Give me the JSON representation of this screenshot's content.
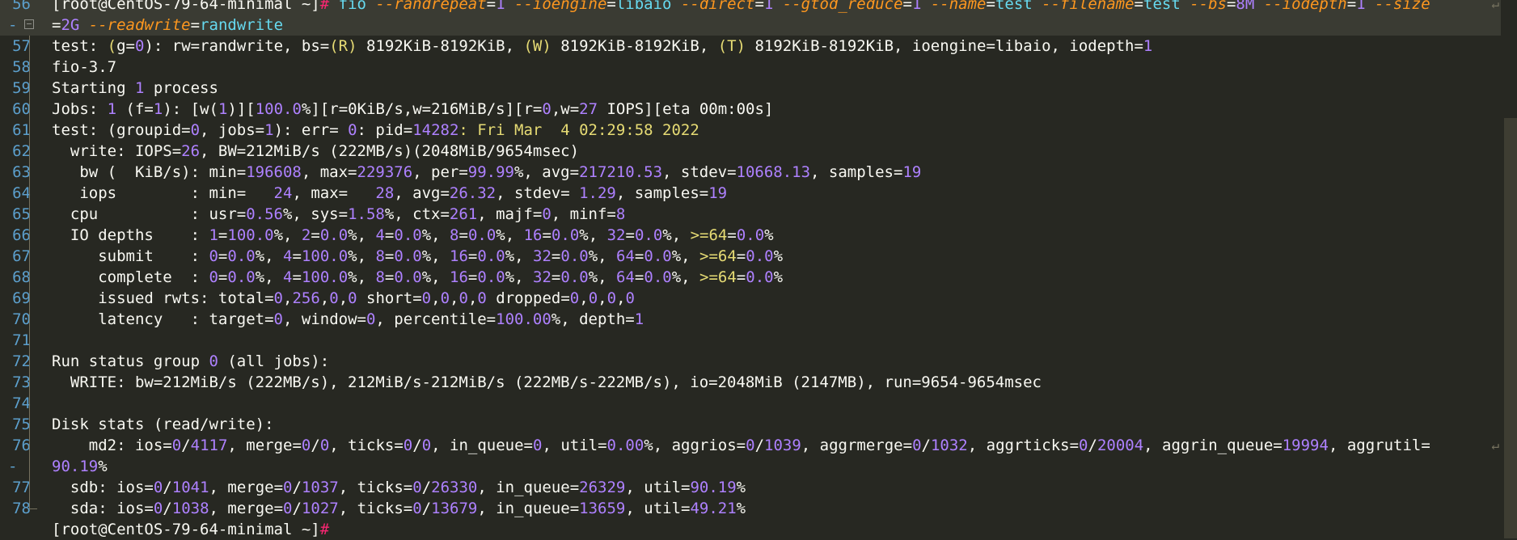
{
  "colors": {
    "background": "#272822",
    "line_number": "#5c9fcc",
    "number": "#ae81ff",
    "keyword_hash": "#f92672",
    "command": "#66d9ef",
    "flag": "#fd971f",
    "string": "#e6db74",
    "text": "#f8f8f2"
  },
  "lines": [
    {
      "gutter": "56",
      "tokens": [
        [
          "[root@CentOS-79-64-minimal ~]",
          "prompt"
        ],
        [
          "# ",
          "hash"
        ],
        [
          "fio ",
          "cmd"
        ],
        [
          "--randrepeat",
          "flag"
        ],
        [
          "=",
          "op"
        ],
        [
          "1 ",
          "num"
        ],
        [
          "--ioengine",
          "flag"
        ],
        [
          "=",
          "op"
        ],
        [
          "libaio ",
          "cmd"
        ],
        [
          "--direct",
          "flag"
        ],
        [
          "=",
          "op"
        ],
        [
          "1 ",
          "num"
        ],
        [
          "--gtod_reduce",
          "flag"
        ],
        [
          "=",
          "op"
        ],
        [
          "1 ",
          "num"
        ],
        [
          "--name",
          "flag"
        ],
        [
          "=",
          "op"
        ],
        [
          "test ",
          "cmd"
        ],
        [
          "--filename",
          "flag"
        ],
        [
          "=",
          "op"
        ],
        [
          "test ",
          "cmd"
        ],
        [
          "--bs",
          "flag"
        ],
        [
          "=",
          "op"
        ],
        [
          "8M ",
          "num"
        ],
        [
          "--iodepth",
          "flag"
        ],
        [
          "=",
          "op"
        ],
        [
          "1 ",
          "num"
        ],
        [
          "--size",
          "flag"
        ]
      ],
      "wrap": true,
      "highlight": true
    },
    {
      "gutter": "-",
      "fold": true,
      "tokens": [
        [
          "=",
          "op"
        ],
        [
          "2G ",
          "num"
        ],
        [
          "--readwrite",
          "flag"
        ],
        [
          "=",
          "op"
        ],
        [
          "randwrite",
          "cmd"
        ]
      ],
      "highlight": true
    },
    {
      "gutter": "57",
      "tokens": [
        [
          "test: ",
          "default"
        ],
        [
          "(",
          "paren"
        ],
        [
          "g",
          "default"
        ],
        [
          "=",
          "op"
        ],
        [
          "0",
          "num"
        ],
        [
          "): rw=randwrite, bs=",
          "default"
        ],
        [
          "(R)",
          "paren"
        ],
        [
          " 8192KiB-8192KiB, ",
          "default"
        ],
        [
          "(W)",
          "paren"
        ],
        [
          " 8192KiB-8192KiB, ",
          "default"
        ],
        [
          "(T)",
          "paren"
        ],
        [
          " 8192KiB-8192KiB, ioengine=libaio, iodepth=",
          "default"
        ],
        [
          "1",
          "num"
        ]
      ]
    },
    {
      "gutter": "58",
      "tokens": [
        [
          "fio-3.7",
          "default"
        ]
      ]
    },
    {
      "gutter": "59",
      "tokens": [
        [
          "Starting ",
          "default"
        ],
        [
          "1",
          "num"
        ],
        [
          " process",
          "default"
        ]
      ]
    },
    {
      "gutter": "60",
      "tokens": [
        [
          "Jobs: ",
          "default"
        ],
        [
          "1",
          "num"
        ],
        [
          " (f=",
          "default"
        ],
        [
          "1",
          "num"
        ],
        [
          "): [w(",
          "default"
        ],
        [
          "1",
          "num"
        ],
        [
          ")][",
          "default"
        ],
        [
          "100.0",
          "num"
        ],
        [
          "%][r=0KiB/s,w=216MiB/s][r=",
          "default"
        ],
        [
          "0",
          "num"
        ],
        [
          ",w=",
          "default"
        ],
        [
          "27",
          "num"
        ],
        [
          " IOPS][eta 00m:00s]",
          "default"
        ]
      ]
    },
    {
      "gutter": "61",
      "tokens": [
        [
          "test: (groupid=",
          "default"
        ],
        [
          "0",
          "num"
        ],
        [
          ", jobs=",
          "default"
        ],
        [
          "1",
          "num"
        ],
        [
          "): err= ",
          "default"
        ],
        [
          "0",
          "num"
        ],
        [
          ": pid=",
          "default"
        ],
        [
          "14282",
          "num"
        ],
        [
          ": Fri Mar  4 02:29:58 2022",
          "str"
        ]
      ]
    },
    {
      "gutter": "62",
      "tokens": [
        [
          "  write: IOPS=",
          "default"
        ],
        [
          "26",
          "num"
        ],
        [
          ", BW=212MiB/s (222MB/s)(2048MiB/9654msec)",
          "default"
        ]
      ]
    },
    {
      "gutter": "63",
      "tokens": [
        [
          "   bw (  KiB/s): min=",
          "default"
        ],
        [
          "196608",
          "num"
        ],
        [
          ", max=",
          "default"
        ],
        [
          "229376",
          "num"
        ],
        [
          ", per=",
          "default"
        ],
        [
          "99.99",
          "num"
        ],
        [
          "%, avg=",
          "default"
        ],
        [
          "217210.53",
          "num"
        ],
        [
          ", stdev=",
          "default"
        ],
        [
          "10668.13",
          "num"
        ],
        [
          ", samples=",
          "default"
        ],
        [
          "19",
          "num"
        ]
      ]
    },
    {
      "gutter": "64",
      "tokens": [
        [
          "   iops        : min=   ",
          "default"
        ],
        [
          "24",
          "num"
        ],
        [
          ", max=   ",
          "default"
        ],
        [
          "28",
          "num"
        ],
        [
          ", avg=",
          "default"
        ],
        [
          "26.32",
          "num"
        ],
        [
          ", stdev= ",
          "default"
        ],
        [
          "1.29",
          "num"
        ],
        [
          ", samples=",
          "default"
        ],
        [
          "19",
          "num"
        ]
      ]
    },
    {
      "gutter": "65",
      "tokens": [
        [
          "  cpu          : usr=",
          "default"
        ],
        [
          "0.56",
          "num"
        ],
        [
          "%, sys=",
          "default"
        ],
        [
          "1.58",
          "num"
        ],
        [
          "%, ctx=",
          "default"
        ],
        [
          "261",
          "num"
        ],
        [
          ", majf=",
          "default"
        ],
        [
          "0",
          "num"
        ],
        [
          ", minf=",
          "default"
        ],
        [
          "8",
          "num"
        ]
      ]
    },
    {
      "gutter": "66",
      "tokens": [
        [
          "  IO depths    : ",
          "default"
        ],
        [
          "1",
          "num"
        ],
        [
          "=",
          "op"
        ],
        [
          "100.0",
          "num"
        ],
        [
          "%, ",
          "default"
        ],
        [
          "2",
          "num"
        ],
        [
          "=",
          "op"
        ],
        [
          "0.0",
          "num"
        ],
        [
          "%, ",
          "default"
        ],
        [
          "4",
          "num"
        ],
        [
          "=",
          "op"
        ],
        [
          "0.0",
          "num"
        ],
        [
          "%, ",
          "default"
        ],
        [
          "8",
          "num"
        ],
        [
          "=",
          "op"
        ],
        [
          "0.0",
          "num"
        ],
        [
          "%, ",
          "default"
        ],
        [
          "16",
          "num"
        ],
        [
          "=",
          "op"
        ],
        [
          "0.0",
          "num"
        ],
        [
          "%, ",
          "default"
        ],
        [
          "32",
          "num"
        ],
        [
          "=",
          "op"
        ],
        [
          "0.0",
          "num"
        ],
        [
          "%, ",
          "default"
        ],
        [
          ">=64",
          "str"
        ],
        [
          "=",
          "op"
        ],
        [
          "0.0",
          "num"
        ],
        [
          "%",
          "default"
        ]
      ]
    },
    {
      "gutter": "67",
      "tokens": [
        [
          "     submit    : ",
          "default"
        ],
        [
          "0",
          "num"
        ],
        [
          "=",
          "op"
        ],
        [
          "0.0",
          "num"
        ],
        [
          "%, ",
          "default"
        ],
        [
          "4",
          "num"
        ],
        [
          "=",
          "op"
        ],
        [
          "100.0",
          "num"
        ],
        [
          "%, ",
          "default"
        ],
        [
          "8",
          "num"
        ],
        [
          "=",
          "op"
        ],
        [
          "0.0",
          "num"
        ],
        [
          "%, ",
          "default"
        ],
        [
          "16",
          "num"
        ],
        [
          "=",
          "op"
        ],
        [
          "0.0",
          "num"
        ],
        [
          "%, ",
          "default"
        ],
        [
          "32",
          "num"
        ],
        [
          "=",
          "op"
        ],
        [
          "0.0",
          "num"
        ],
        [
          "%, ",
          "default"
        ],
        [
          "64",
          "num"
        ],
        [
          "=",
          "op"
        ],
        [
          "0.0",
          "num"
        ],
        [
          "%, ",
          "default"
        ],
        [
          ">=64",
          "str"
        ],
        [
          "=",
          "op"
        ],
        [
          "0.0",
          "num"
        ],
        [
          "%",
          "default"
        ]
      ]
    },
    {
      "gutter": "68",
      "tokens": [
        [
          "     complete  : ",
          "default"
        ],
        [
          "0",
          "num"
        ],
        [
          "=",
          "op"
        ],
        [
          "0.0",
          "num"
        ],
        [
          "%, ",
          "default"
        ],
        [
          "4",
          "num"
        ],
        [
          "=",
          "op"
        ],
        [
          "100.0",
          "num"
        ],
        [
          "%, ",
          "default"
        ],
        [
          "8",
          "num"
        ],
        [
          "=",
          "op"
        ],
        [
          "0.0",
          "num"
        ],
        [
          "%, ",
          "default"
        ],
        [
          "16",
          "num"
        ],
        [
          "=",
          "op"
        ],
        [
          "0.0",
          "num"
        ],
        [
          "%, ",
          "default"
        ],
        [
          "32",
          "num"
        ],
        [
          "=",
          "op"
        ],
        [
          "0.0",
          "num"
        ],
        [
          "%, ",
          "default"
        ],
        [
          "64",
          "num"
        ],
        [
          "=",
          "op"
        ],
        [
          "0.0",
          "num"
        ],
        [
          "%, ",
          "default"
        ],
        [
          ">=64",
          "str"
        ],
        [
          "=",
          "op"
        ],
        [
          "0.0",
          "num"
        ],
        [
          "%",
          "default"
        ]
      ]
    },
    {
      "gutter": "69",
      "tokens": [
        [
          "     issued rwts: total=",
          "default"
        ],
        [
          "0",
          "num"
        ],
        [
          ",",
          "default"
        ],
        [
          "256",
          "num"
        ],
        [
          ",",
          "default"
        ],
        [
          "0",
          "num"
        ],
        [
          ",",
          "default"
        ],
        [
          "0",
          "num"
        ],
        [
          " short=",
          "default"
        ],
        [
          "0",
          "num"
        ],
        [
          ",",
          "default"
        ],
        [
          "0",
          "num"
        ],
        [
          ",",
          "default"
        ],
        [
          "0",
          "num"
        ],
        [
          ",",
          "default"
        ],
        [
          "0",
          "num"
        ],
        [
          " dropped=",
          "default"
        ],
        [
          "0",
          "num"
        ],
        [
          ",",
          "default"
        ],
        [
          "0",
          "num"
        ],
        [
          ",",
          "default"
        ],
        [
          "0",
          "num"
        ],
        [
          ",",
          "default"
        ],
        [
          "0",
          "num"
        ]
      ]
    },
    {
      "gutter": "70",
      "tokens": [
        [
          "     latency   : target=",
          "default"
        ],
        [
          "0",
          "num"
        ],
        [
          ", window=",
          "default"
        ],
        [
          "0",
          "num"
        ],
        [
          ", percentile=",
          "default"
        ],
        [
          "100.00",
          "num"
        ],
        [
          "%, depth=",
          "default"
        ],
        [
          "1",
          "num"
        ]
      ]
    },
    {
      "gutter": "71",
      "tokens": []
    },
    {
      "gutter": "72",
      "tokens": [
        [
          "Run status group ",
          "default"
        ],
        [
          "0",
          "num"
        ],
        [
          " (all jobs):",
          "default"
        ]
      ]
    },
    {
      "gutter": "73",
      "tokens": [
        [
          "  WRITE: bw=212MiB/s (222MB/s), 212MiB/s-212MiB/s (222MB/s-222MB/s), io=2048MiB (2147MB), run=9654-9654msec",
          "default"
        ]
      ]
    },
    {
      "gutter": "74",
      "tokens": []
    },
    {
      "gutter": "75",
      "tokens": [
        [
          "Disk stats (read/write):",
          "default"
        ]
      ]
    },
    {
      "gutter": "76",
      "tokens": [
        [
          "    md2: ios=",
          "default"
        ],
        [
          "0",
          "num"
        ],
        [
          "/",
          "default"
        ],
        [
          "4117",
          "num"
        ],
        [
          ", merge=",
          "default"
        ],
        [
          "0",
          "num"
        ],
        [
          "/",
          "default"
        ],
        [
          "0",
          "num"
        ],
        [
          ", ticks=",
          "default"
        ],
        [
          "0",
          "num"
        ],
        [
          "/",
          "default"
        ],
        [
          "0",
          "num"
        ],
        [
          ", in_queue=",
          "default"
        ],
        [
          "0",
          "num"
        ],
        [
          ", util=",
          "default"
        ],
        [
          "0.00",
          "num"
        ],
        [
          "%, aggrios=",
          "default"
        ],
        [
          "0",
          "num"
        ],
        [
          "/",
          "default"
        ],
        [
          "1039",
          "num"
        ],
        [
          ", aggrmerge=",
          "default"
        ],
        [
          "0",
          "num"
        ],
        [
          "/",
          "default"
        ],
        [
          "1032",
          "num"
        ],
        [
          ", aggrticks=",
          "default"
        ],
        [
          "0",
          "num"
        ],
        [
          "/",
          "default"
        ],
        [
          "20004",
          "num"
        ],
        [
          ", aggrin_queue=",
          "default"
        ],
        [
          "19994",
          "num"
        ],
        [
          ", aggrutil=",
          "default"
        ]
      ],
      "wrap": true
    },
    {
      "gutter": "-",
      "tokens": [
        [
          "90.19",
          "num"
        ],
        [
          "%",
          "default"
        ]
      ]
    },
    {
      "gutter": "77",
      "tokens": [
        [
          "  sdb: ios=",
          "default"
        ],
        [
          "0",
          "num"
        ],
        [
          "/",
          "default"
        ],
        [
          "1041",
          "num"
        ],
        [
          ", merge=",
          "default"
        ],
        [
          "0",
          "num"
        ],
        [
          "/",
          "default"
        ],
        [
          "1037",
          "num"
        ],
        [
          ", ticks=",
          "default"
        ],
        [
          "0",
          "num"
        ],
        [
          "/",
          "default"
        ],
        [
          "26330",
          "num"
        ],
        [
          ", in_queue=",
          "default"
        ],
        [
          "26329",
          "num"
        ],
        [
          ", util=",
          "default"
        ],
        [
          "90.19",
          "num"
        ],
        [
          "%",
          "default"
        ]
      ]
    },
    {
      "gutter": "78",
      "guide_end": true,
      "tokens": [
        [
          "  sda: ios=",
          "default"
        ],
        [
          "0",
          "num"
        ],
        [
          "/",
          "default"
        ],
        [
          "1038",
          "num"
        ],
        [
          ", merge=",
          "default"
        ],
        [
          "0",
          "num"
        ],
        [
          "/",
          "default"
        ],
        [
          "1027",
          "num"
        ],
        [
          ", ticks=",
          "default"
        ],
        [
          "0",
          "num"
        ],
        [
          "/",
          "default"
        ],
        [
          "13679",
          "num"
        ],
        [
          ", in_queue=",
          "default"
        ],
        [
          "13659",
          "num"
        ],
        [
          ", util=",
          "default"
        ],
        [
          "49.21",
          "num"
        ],
        [
          "%",
          "default"
        ]
      ]
    },
    {
      "gutter": "",
      "tokens": [
        [
          "[root@CentOS-79-64-minimal ~]",
          "prompt"
        ],
        [
          "# ",
          "hash"
        ]
      ],
      "cut": true
    }
  ]
}
